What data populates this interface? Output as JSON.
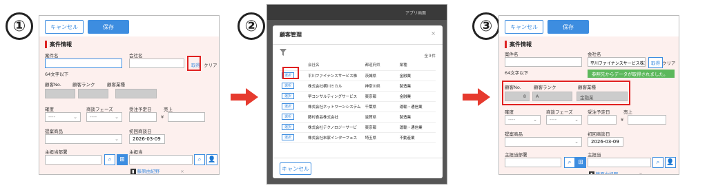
{
  "steps": [
    "①",
    "②",
    "③"
  ],
  "form": {
    "cancel_label": "キャンセル",
    "save_label": "保存",
    "section_title": "案件情報",
    "project_name_label": "案件名",
    "company_label": "会社名",
    "acquire_label": "取得",
    "clear_label": "クリア",
    "limit_note": "64文字以下",
    "customer_no_label": "顧客No.",
    "customer_rank_label": "顧客ランク",
    "customer_industry_label": "顧客業種",
    "certainty_label": "確度",
    "deal_phase_label": "商談フェーズ",
    "order_date_label": "受注予定日",
    "sales_label": "売上",
    "currency_symbol": "¥",
    "product_label": "提案商品",
    "first_visit_label": "初回商談日",
    "first_visit_value": "2026-03-09",
    "main_dept_label": "主担当部署",
    "main_person_label": "主担当",
    "person_name": "藤原由紀野",
    "select_placeholder": "----"
  },
  "modal": {
    "header_app": "アプリ画面",
    "title": "顧客管理",
    "count": "全９件",
    "columns": [
      "",
      "会社名",
      "都道府県",
      "業種"
    ],
    "select_label": "選択",
    "rows": [
      {
        "company": "平川ファイナンスサービス株",
        "pref": "茨城県",
        "industry": "金融業"
      },
      {
        "company": "株式会社横川ミカル",
        "pref": "神奈川県",
        "industry": "製造業"
      },
      {
        "company": "早コンサルティングサービス",
        "pref": "東京都",
        "industry": "金融業"
      },
      {
        "company": "株式会社ネットワーンシステム",
        "pref": "千葉県",
        "industry": "運輸・通信業"
      },
      {
        "company": "藤村食品株式会社",
        "pref": "滋賀県",
        "industry": "製造業"
      },
      {
        "company": "株式会社テクノロジーサービ",
        "pref": "東京都",
        "industry": "運輸・通信業"
      },
      {
        "company": "株式会社末家インターフェス",
        "pref": "埼玉県",
        "industry": "不動産業"
      }
    ],
    "cancel_label": "キャンセル"
  },
  "result": {
    "company_value": "平川ファイナンスサービス株式",
    "fetched_message": "参照先からデータが取得されました。",
    "customer_no_value": "8",
    "customer_rank_value": "A",
    "customer_industry_value": "金融業"
  },
  "colors": {
    "accent": "#3d8de0",
    "highlight": "#e02020",
    "success": "#5cb85c"
  }
}
